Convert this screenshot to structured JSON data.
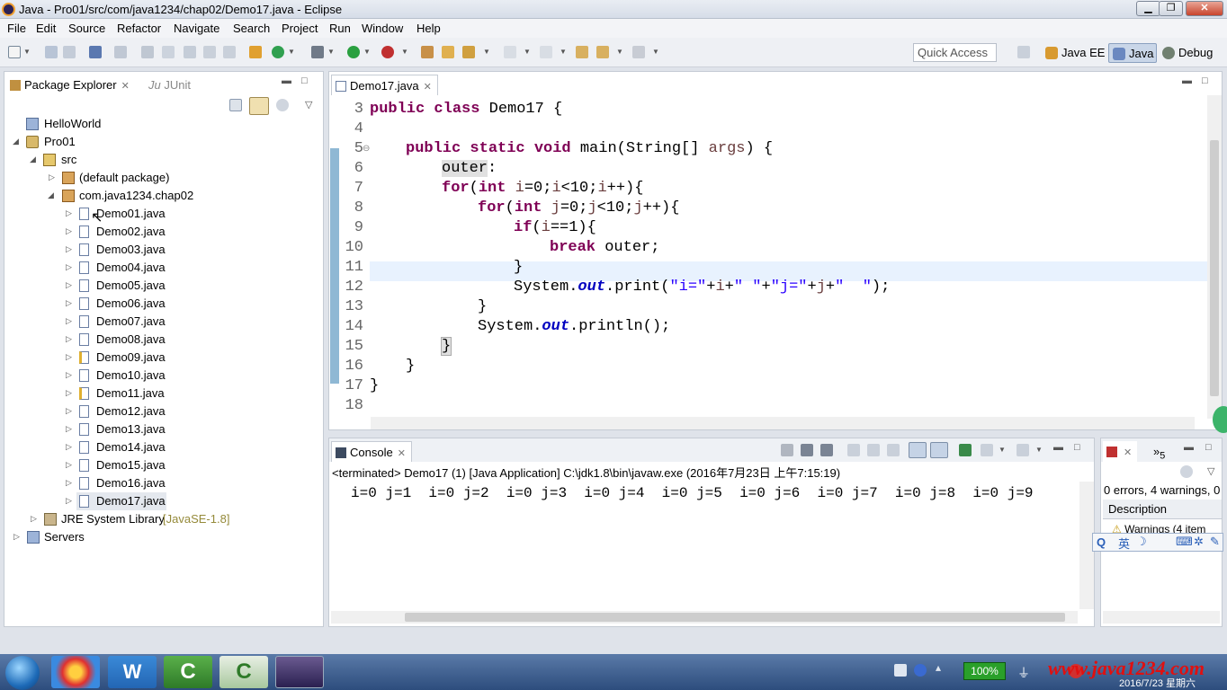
{
  "window": {
    "title": "Java - Pro01/src/com/java1234/chap02/Demo17.java - Eclipse",
    "minimize": "▁",
    "maximize": "❐",
    "close": "✕"
  },
  "menu": [
    "File",
    "Edit",
    "Source",
    "Refactor",
    "Navigate",
    "Search",
    "Project",
    "Run",
    "Window",
    "Help"
  ],
  "toolbar": {
    "quick_access": "Quick Access",
    "perspectives": [
      {
        "label": "Java EE",
        "icon": "java-ee-perspective-icon"
      },
      {
        "label": "Java",
        "icon": "java-perspective-icon",
        "active": true
      },
      {
        "label": "Debug",
        "icon": "debug-perspective-icon"
      }
    ]
  },
  "package_explorer": {
    "tabs": [
      {
        "label": "Package Explorer",
        "active": true
      },
      {
        "label": "JUnit",
        "prefix": "Ju"
      }
    ],
    "tree": [
      {
        "label": "HelloWorld",
        "type": "project"
      },
      {
        "label": "Pro01",
        "type": "project",
        "expanded": true
      },
      {
        "label": "src",
        "type": "src",
        "expanded": true
      },
      {
        "label": "(default package)",
        "type": "package"
      },
      {
        "label": "com.java1234.chap02",
        "type": "package",
        "expanded": true
      },
      {
        "label": "Demo01.java",
        "type": "file"
      },
      {
        "label": "Demo02.java",
        "type": "file"
      },
      {
        "label": "Demo03.java",
        "type": "file"
      },
      {
        "label": "Demo04.java",
        "type": "file"
      },
      {
        "label": "Demo05.java",
        "type": "file"
      },
      {
        "label": "Demo06.java",
        "type": "file"
      },
      {
        "label": "Demo07.java",
        "type": "file"
      },
      {
        "label": "Demo08.java",
        "type": "file"
      },
      {
        "label": "Demo09.java",
        "type": "file"
      },
      {
        "label": "Demo10.java",
        "type": "file"
      },
      {
        "label": "Demo11.java",
        "type": "file"
      },
      {
        "label": "Demo12.java",
        "type": "file"
      },
      {
        "label": "Demo13.java",
        "type": "file"
      },
      {
        "label": "Demo14.java",
        "type": "file"
      },
      {
        "label": "Demo15.java",
        "type": "file"
      },
      {
        "label": "Demo16.java",
        "type": "file"
      },
      {
        "label": "Demo17.java",
        "type": "file",
        "selected": true
      },
      {
        "label": "JRE System Library",
        "suffix": "[JavaSE-1.8]",
        "type": "library"
      },
      {
        "label": "Servers",
        "type": "folder"
      }
    ]
  },
  "editor": {
    "tab": "Demo17.java",
    "line_numbers": [
      "3",
      "4",
      "5",
      "6",
      "7",
      "8",
      "9",
      "10",
      "11",
      "12",
      "13",
      "14",
      "15",
      "16",
      "17",
      "18"
    ],
    "code": {
      "l3a": "public class",
      "l3b": " Demo17 {",
      "l5a": "public static void",
      "l5b": " main(String[] ",
      "l5c": "args",
      "l5d": ") {",
      "l6a": "outer",
      "l6b": ":",
      "l7a": "for",
      "l7b": "(",
      "l7c": "int",
      "l7d": " ",
      "l7e": "i",
      "l7f": "=0;",
      "l7g": "i",
      "l7h": "<10;",
      "l7i": "i",
      "l7j": "++){",
      "l8a": "for",
      "l8b": "(",
      "l8c": "int",
      "l8d": " ",
      "l8e": "j",
      "l8f": "=0;",
      "l8g": "j",
      "l8h": "<10;",
      "l8i": "j",
      "l8j": "++){",
      "l9a": "if",
      "l9b": "(",
      "l9c": "i",
      "l9d": "==1){",
      "l10a": "break",
      "l10b": " outer;",
      "l11": "}",
      "l12a": "System.",
      "l12b": "out",
      "l12c": ".print(",
      "l12d": "\"i=\"",
      "l12e": "+",
      "l12f": "i",
      "l12g": "+",
      "l12h": "\" \"",
      "l12i": "+",
      "l12j": "\"j=\"",
      "l12k": "+",
      "l12l": "j",
      "l12m": "+",
      "l12n": "\"  \"",
      "l12o": ");",
      "l13": "}",
      "l14a": "System.",
      "l14b": "out",
      "l14c": ".println();",
      "l15": "}",
      "l16": "}",
      "l17": "}"
    }
  },
  "console": {
    "tab": "Console",
    "status": "<terminated> Demo17 (1) [Java Application] C:\\jdk1.8\\bin\\javaw.exe (2016年7月23日 上午7:15:19)",
    "output": "i=0 j=1  i=0 j=2  i=0 j=3  i=0 j=4  i=0 j=5  i=0 j=6  i=0 j=7  i=0 j=8  i=0 j=9"
  },
  "problems": {
    "tab_suffix": "5",
    "summary": "0 errors, 4 warnings, 0",
    "column": "Description",
    "row": "Warnings (4 item"
  },
  "ime": {
    "mode": "英"
  },
  "taskbar": {
    "battery": "100%",
    "date": "2016/7/23 星期六",
    "watermark": "www.java1234.com"
  },
  "colors": {
    "keyword": "#7f0055",
    "string": "#2a00ff",
    "field": "#0000c0",
    "selection": "#c6d9f0"
  }
}
